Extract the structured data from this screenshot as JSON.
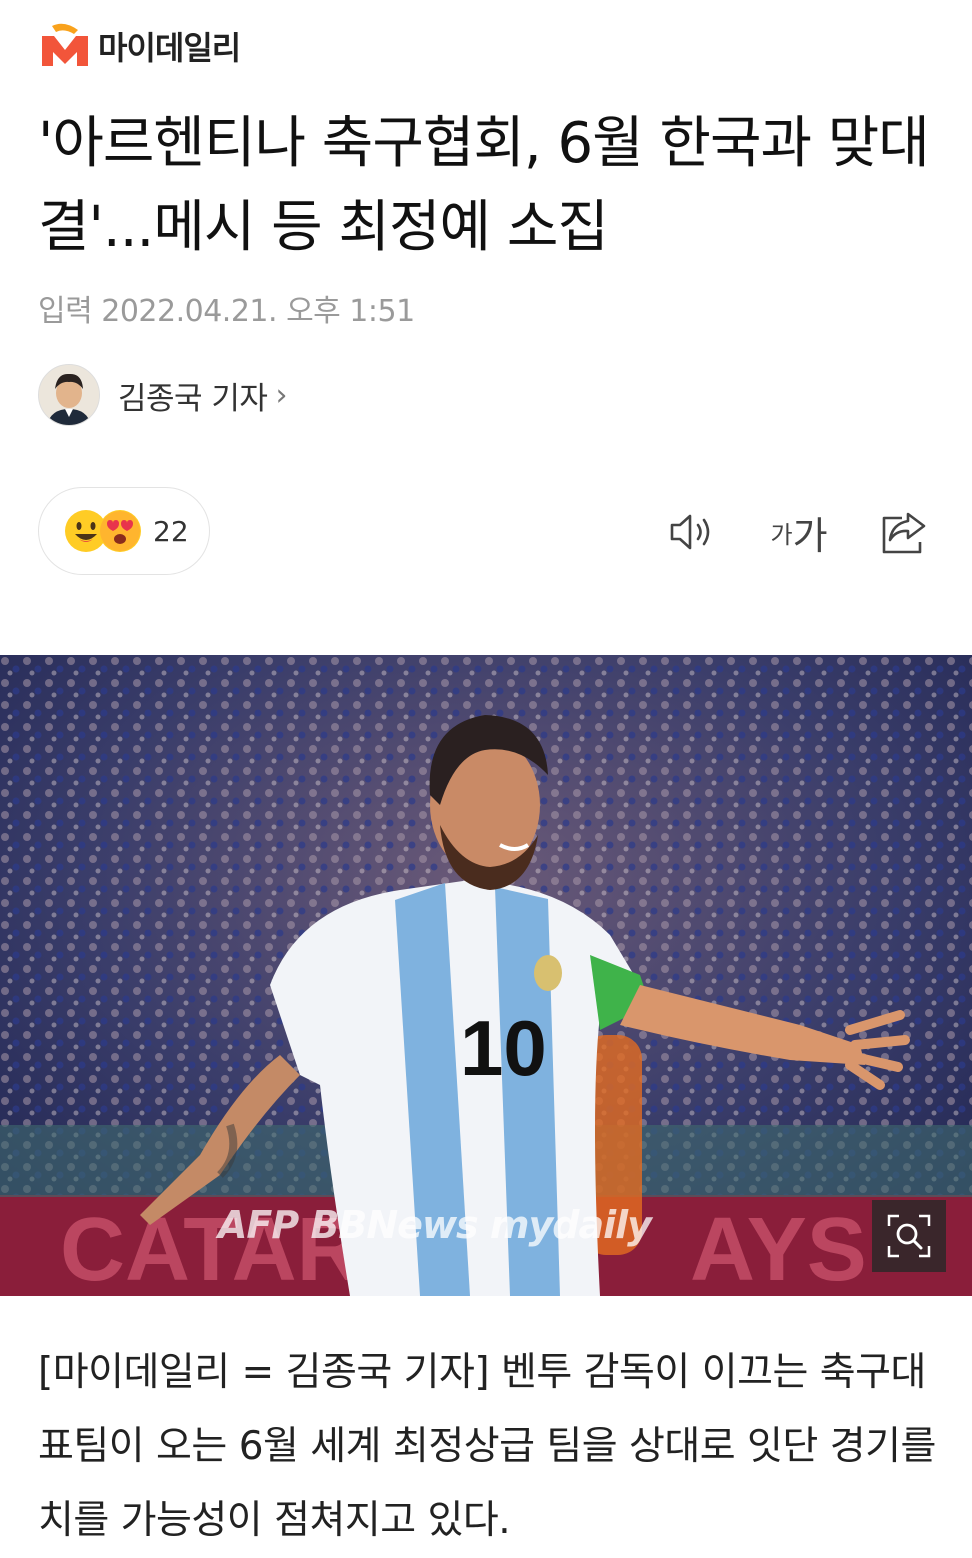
{
  "brand": {
    "name": "마이데일리",
    "accent": "#f2553a",
    "accent2": "#f9a21c"
  },
  "article": {
    "headline": "'아르헨티나 축구협회, 6월 한국과 맞대결'...메시 등 최정예 소집",
    "published": "입력 2022.04.21. 오후 1:51",
    "author": "김종국 기자",
    "author_chevron": "›",
    "reactions": {
      "emojis": [
        "smile-emoji",
        "heart-eyes-emoji"
      ],
      "count": "22"
    },
    "toolbar": {
      "speaker": "speaker-icon",
      "font_small": "가",
      "font_large": "가",
      "share": "share-icon"
    },
    "photo": {
      "watermark": "AFP BBNews mydaily",
      "zoom": "magnify-icon"
    },
    "body": "[마이데일리 = 김종국 기자] 벤투 감독이 이끄는 축구대표팀이 오는 6월 세계 최정상급 팀을 상대로 잇단 경기를 치를 가능성이 점쳐지고 있다."
  }
}
